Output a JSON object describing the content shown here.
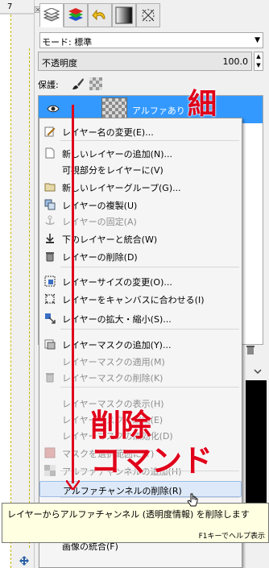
{
  "ruler": {
    "number": "7"
  },
  "mode": {
    "label": "モード: 標準"
  },
  "opacity": {
    "label": "不透明度",
    "value": "100.0"
  },
  "lock": {
    "label": "保護:"
  },
  "layer": {
    "name": "アルファあり"
  },
  "menu": {
    "items": [
      {
        "label": "レイヤー名の変更(E)...",
        "icon": "rename-icon",
        "disabled": false
      },
      {
        "label": "新しいレイヤーの追加(N)...",
        "icon": "new-layer-icon",
        "disabled": false
      },
      {
        "label": "可視部分をレイヤーに(V)",
        "icon": "",
        "disabled": false
      },
      {
        "label": "新しいレイヤーグループ(G)...",
        "icon": "folder-icon",
        "disabled": false
      },
      {
        "label": "レイヤーの複製(U)",
        "icon": "duplicate-icon",
        "disabled": false
      },
      {
        "label": "レイヤーの固定(A)",
        "icon": "anchor-icon",
        "disabled": true
      },
      {
        "label": "下のレイヤーと統合(W)",
        "icon": "merge-down-icon",
        "disabled": false
      },
      {
        "label": "レイヤーの削除(D)",
        "icon": "trash-icon",
        "disabled": false
      },
      {
        "label": "レイヤーサイズの変更(O)...",
        "icon": "layer-size-icon",
        "disabled": false
      },
      {
        "label": "レイヤーをキャンバスに合わせる(I)",
        "icon": "fit-canvas-icon",
        "disabled": false
      },
      {
        "label": "レイヤーの拡大・縮小(S)...",
        "icon": "scale-icon",
        "disabled": false
      },
      {
        "label": "レイヤーマスクの追加(Y)...",
        "icon": "add-mask-icon",
        "disabled": false
      },
      {
        "label": "レイヤーマスクの適用(M)",
        "icon": "",
        "disabled": true
      },
      {
        "label": "レイヤーマスクの削除(K)",
        "icon": "trash-icon",
        "disabled": true
      },
      {
        "label": "レイヤーマスクの表示(H)",
        "icon": "",
        "disabled": true
      },
      {
        "label": "レイヤーマスクの編集(E)",
        "icon": "",
        "disabled": true
      },
      {
        "label": "レイヤーマスクの無効化(D)",
        "icon": "",
        "disabled": true
      },
      {
        "label": "マスクを選択範囲に(T)",
        "icon": "mask-selection-icon",
        "disabled": true
      },
      {
        "label": "アルファチャンネルの追加(H)",
        "icon": "alpha-add-icon",
        "disabled": true
      },
      {
        "label": "アルファチャンネルの削除(R)",
        "icon": "",
        "disabled": false
      },
      {
        "label": "画像の統合(F)",
        "icon": "",
        "disabled": false
      }
    ]
  },
  "tooltip": {
    "text": "レイヤーからアルファチャンネル (透明度情報) を削除します",
    "help": "F1キーでヘルプ表示"
  },
  "annotations": {
    "thin": "細",
    "delete": "削除",
    "command": "コマンド",
    "color": "#e0001a"
  }
}
